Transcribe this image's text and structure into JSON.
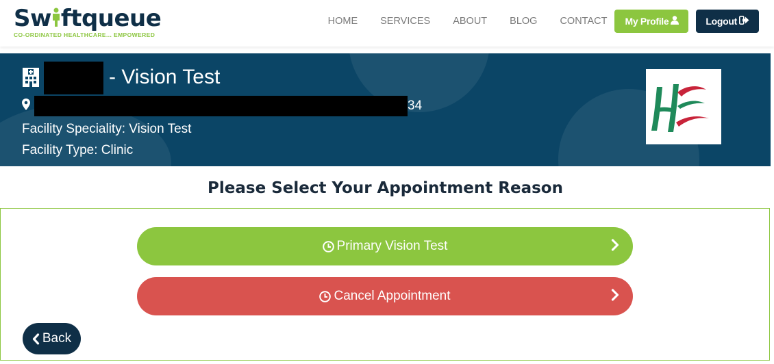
{
  "brand": {
    "name_pre": "Sw",
    "name_post": "ftqueue",
    "tagline": "CO-ORDINATED HEALTHCARE... EMPOWERED",
    "primary_color": "#0f2f47",
    "accent_color": "#8cc63f"
  },
  "nav": {
    "links": [
      "HOME",
      "SERVICES",
      "ABOUT",
      "BLOG",
      "CONTACT"
    ],
    "profile_label": "My Profile",
    "logout_label": "Logout"
  },
  "facility": {
    "title_suffix": "- Vision Test",
    "address_tail": "34",
    "speciality": "Facility Speciality: Vision Test",
    "type": "Facility Type: Clinic",
    "banner_color": "#0b4566",
    "icons": [
      "hospital-icon",
      "map-marker-icon",
      "hse-logo"
    ]
  },
  "page": {
    "heading": "Please Select Your Appointment Reason"
  },
  "reasons": [
    {
      "label": "Primary Vision Test",
      "color": "#8cc63f",
      "icon": "clock-icon"
    },
    {
      "label": "Cancel Appointment",
      "color": "#d9534f",
      "icon": "clock-icon"
    }
  ],
  "back_label": "Back"
}
